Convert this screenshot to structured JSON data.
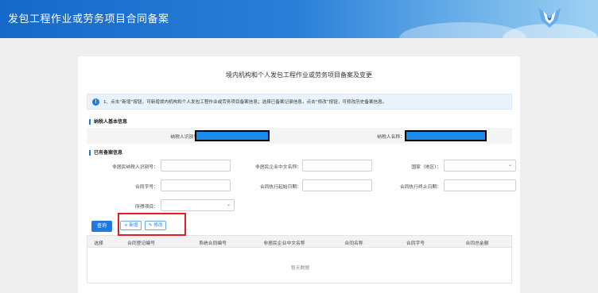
{
  "header": {
    "app_title": "发包工程作业或劳务项目合同备案"
  },
  "page": {
    "title": "境内机构和个人发包工程作业或劳务项目备案及变更",
    "notice": "1、点击“新增”按钮，可新增境内机构和个人发包工程作业或劳务项目备案信息；选择已备案记录信息，点击“修改”按钮，可修改历史备案信息。"
  },
  "taxpayer": {
    "section_title": "纳税人基本信息",
    "id_label": "纳税人识别号：",
    "name_label": "纳税人名称："
  },
  "filed": {
    "section_title": "已有备案信息",
    "nonresident_id_label": "非居民纳税人识别号：",
    "nonresident_name_label": "非居民企业中文名称：",
    "country_label": "国家（地区）：",
    "contract_no_label": "合同字号：",
    "start_date_label": "合同执行起始日期：",
    "end_date_label": "合同执行终止日期：",
    "income_item_label": "所得项目："
  },
  "actions": {
    "query": "查询",
    "add": "+ 新增",
    "edit": "✎ 修改"
  },
  "table": {
    "headers": [
      "选择",
      "合同登记编号",
      "系统合同编号",
      "非居民企业中文名称",
      "合同名称",
      "合同字号",
      "合同总金额"
    ],
    "empty": "暂无数据"
  },
  "colors": {
    "accent": "#1f7ae0",
    "redaction": "#1a8bea",
    "highlight_box": "#e02020"
  }
}
